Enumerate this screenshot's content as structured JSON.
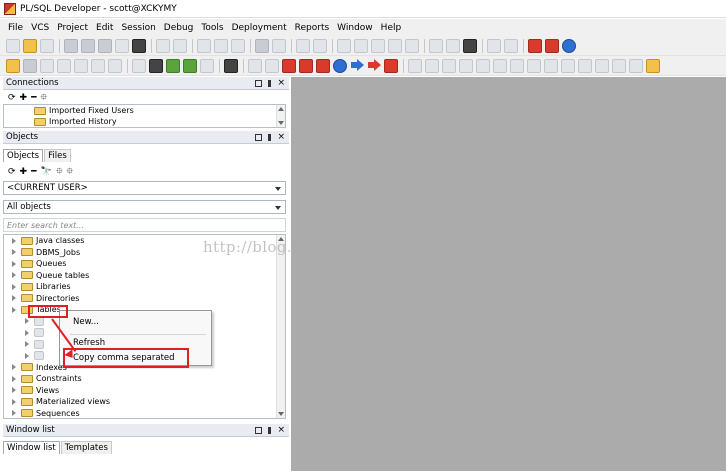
{
  "window": {
    "title": "PL/SQL Developer - scott@XCKYMY"
  },
  "menu": [
    "File",
    "VCS",
    "Project",
    "Edit",
    "Session",
    "Debug",
    "Tools",
    "Deployment",
    "Reports",
    "Window",
    "Help"
  ],
  "panels": {
    "connections": {
      "title": "Connections",
      "items": [
        "Imported Fixed Users",
        "Imported History"
      ]
    },
    "objects": {
      "title": "Objects",
      "tabs": [
        "Objects",
        "Files"
      ],
      "user_select": "<CURRENT USER>",
      "filter_select": "All objects",
      "search_placeholder": "Enter search text...",
      "tree_items": [
        "Java classes",
        "DBMS_Jobs",
        "Queues",
        "Queue tables",
        "Libraries",
        "Directories",
        "Tables",
        "Indexes",
        "Constraints",
        "Views",
        "Materialized views",
        "Sequences"
      ]
    },
    "window_list": {
      "title": "Window list",
      "tabs": [
        "Window list",
        "Templates"
      ]
    }
  },
  "context_menu": {
    "items": [
      "New...",
      "Refresh",
      "Copy comma separated"
    ]
  },
  "watermark": "http://blog.csdn.net/huangyanlong",
  "colors": {
    "highlight": "#e02020",
    "workspace": "#ababab",
    "folder": "#f1cf6b"
  },
  "icons": [
    "refresh-icon",
    "add-icon",
    "remove-icon",
    "filter-icon",
    "find-icon"
  ]
}
